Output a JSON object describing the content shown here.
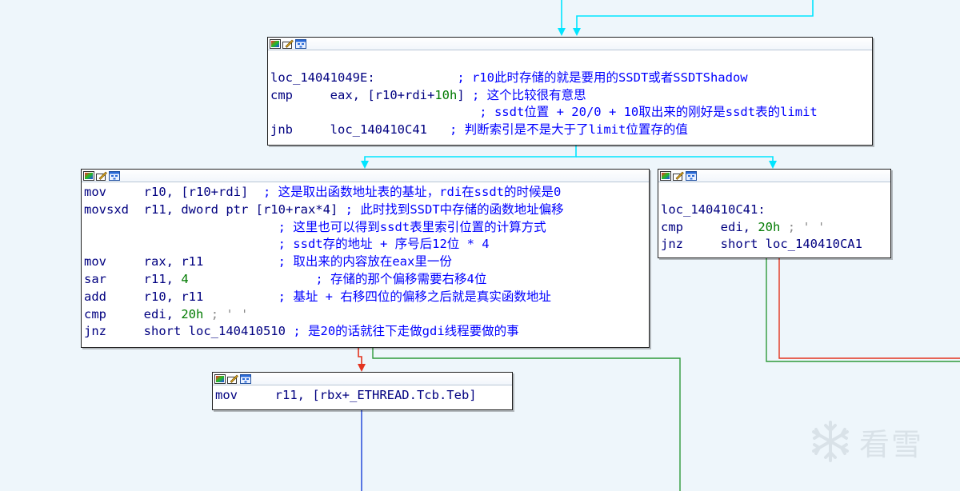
{
  "colors": {
    "background": "#eef6fb",
    "edge_cyan": "#00e5ff",
    "edge_red": "#e3341f",
    "edge_green": "#2e9a3a",
    "edge_blue": "#1740d8",
    "mnemonic": "#000080",
    "comment": "#0000ff",
    "number": "#007a00"
  },
  "icons": [
    "graph-color-icon",
    "rename-icon",
    "graph-view-icon"
  ],
  "nodes": {
    "top": {
      "lines": [
        {
          "label": "loc_14041049E:",
          "comment": "; r10此时存储的就是要用的SSDT或者SSDTShadow"
        },
        {
          "mnemonic": "cmp",
          "operands_a": "eax, [r10+rdi+",
          "number": "10h",
          "operands_b": "]",
          "comment": "; 这个比较很有意思"
        },
        {
          "comment": "; ssdt位置 + 20/0 + 10取出来的刚好是ssdt表的limit"
        },
        {
          "mnemonic": "jnb",
          "operands_a": "loc_140410C41",
          "comment": "; 判断索引是不是大于了limit位置存的值"
        }
      ]
    },
    "left": {
      "lines": [
        {
          "mnemonic": "mov",
          "operands_a": "r10, [r10+rdi]",
          "comment": "; 这是取出函数地址表的基址，rdi在ssdt的时候是0"
        },
        {
          "mnemonic": "movsxd",
          "operands_a": "r11, dword ptr [r10+rax*4]",
          "comment": "; 此时找到SSDT中存储的函数地址偏移"
        },
        {
          "comment": "; 这里也可以得到ssdt表里索引位置的计算方式"
        },
        {
          "comment": "; ssdt存的地址 + 序号后12位 * 4"
        },
        {
          "mnemonic": "mov",
          "operands_a": "rax, r11",
          "comment": "; 取出来的内容放在eax里一份"
        },
        {
          "mnemonic": "sar",
          "operands_a": "r11, ",
          "number": "4",
          "comment": "; 存储的那个偏移需要右移4位"
        },
        {
          "mnemonic": "add",
          "operands_a": "r10, r11",
          "comment": "; 基址 + 右移四位的偏移之后就是真实函数地址"
        },
        {
          "mnemonic": "cmp",
          "operands_a": "edi, ",
          "number": "20h",
          "comment": "; ' '"
        },
        {
          "mnemonic": "jnz",
          "operands_a": "short loc_140410510",
          "comment": "; 是20的话就往下走做gdi线程要做的事"
        }
      ]
    },
    "right": {
      "lines": [
        {
          "label": "loc_140410C41:"
        },
        {
          "mnemonic": "cmp",
          "operands_a": "edi, ",
          "number": "20h",
          "comment": "; ' '"
        },
        {
          "mnemonic": "jnz",
          "operands_a": "short loc_140410CA1"
        }
      ]
    },
    "bottom": {
      "lines": [
        {
          "mnemonic": "mov",
          "operands_a": "r11, [rbx+_ETHREAD.Tcb.Teb]"
        }
      ]
    }
  },
  "watermark": {
    "text": "看雪",
    "icon": "snowflake-icon"
  }
}
